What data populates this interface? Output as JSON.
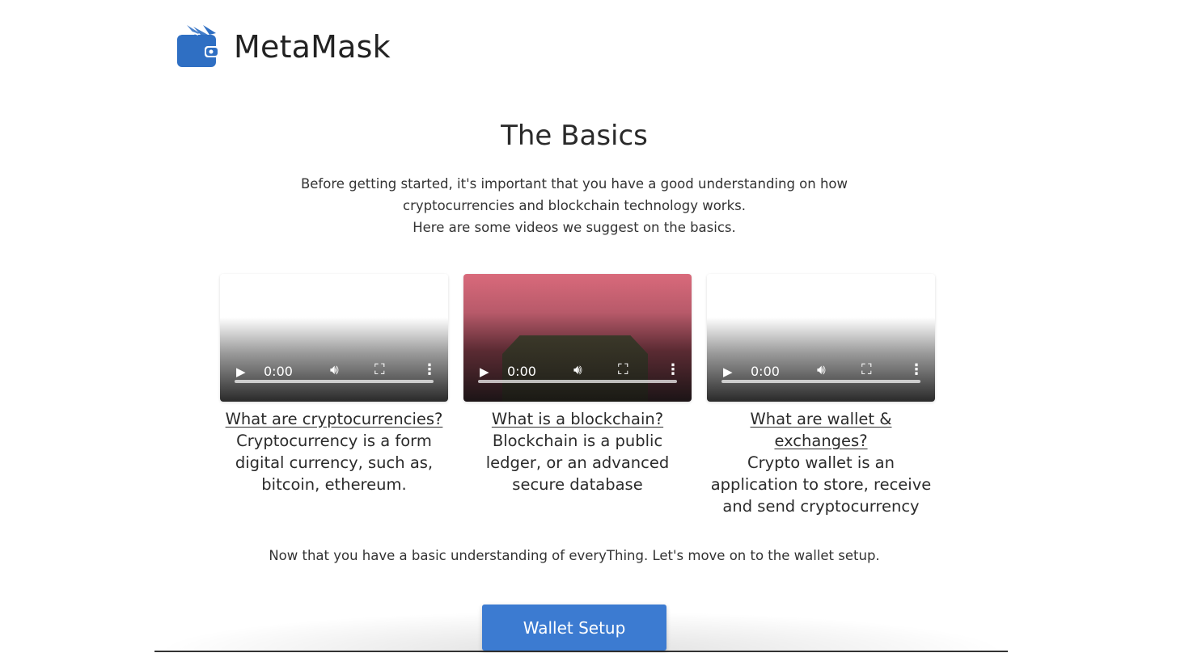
{
  "brand": {
    "name": "MetaMask",
    "logo_icon": "wallet-icon",
    "logo_color": "#2f6fc3"
  },
  "basics": {
    "title": "The Basics",
    "intro_line1": "Before getting started, it's important that you have a good understanding on how",
    "intro_line2": "cryptocurrencies and blockchain technology works.",
    "intro_line3": "Here are some videos we suggest on the basics."
  },
  "videos": [
    {
      "time": "0:00",
      "link": "What are cryptocurrencies?",
      "desc": "Cryptocurrency is a form digital currency, such as, bitcoin, ethereum."
    },
    {
      "time": "0:00",
      "link": "What is a blockchain?",
      "desc": "Blockchain is a public ledger, or an advanced secure database"
    },
    {
      "time": "0:00",
      "link": "What are wallet & exchanges?",
      "desc": "Crypto wallet is an application to store, receive and send cryptocurrency"
    }
  ],
  "icons": {
    "play": "play-icon",
    "volume": "volume-icon",
    "fullscreen": "fullscreen-icon",
    "more": "more-vertical-icon"
  },
  "outro": "Now that you have a basic understanding of everyThing. Let's move on to the wallet setup.",
  "cta": {
    "label": "Wallet Setup",
    "color": "#3c7bd1"
  }
}
